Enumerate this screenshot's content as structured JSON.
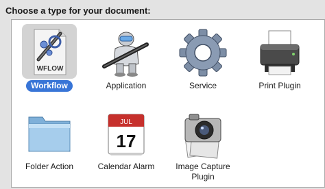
{
  "dialog": {
    "heading": "Choose a type for your document:"
  },
  "types": [
    {
      "label": "Workflow",
      "icon": "workflow-icon",
      "icon_text": "WFLOW",
      "selected": true
    },
    {
      "label": "Application",
      "icon": "automator-robot-icon",
      "selected": false
    },
    {
      "label": "Service",
      "icon": "gear-icon",
      "selected": false
    },
    {
      "label": "Print Plugin",
      "icon": "printer-icon",
      "selected": false
    },
    {
      "label": "Folder Action",
      "icon": "folder-icon",
      "selected": false
    },
    {
      "label": "Calendar Alarm",
      "icon": "calendar-icon",
      "calendar_month": "JUL",
      "calendar_day": "17",
      "selected": false
    },
    {
      "label": "Image Capture\nPlugin",
      "label_line1": "Image Capture",
      "label_line2": "Plugin",
      "icon": "camera-icon",
      "selected": false
    }
  ],
  "colors": {
    "selection_blue": "#3875d7",
    "selection_gray": "#d3d3d3",
    "background": "#e3e3e3"
  }
}
